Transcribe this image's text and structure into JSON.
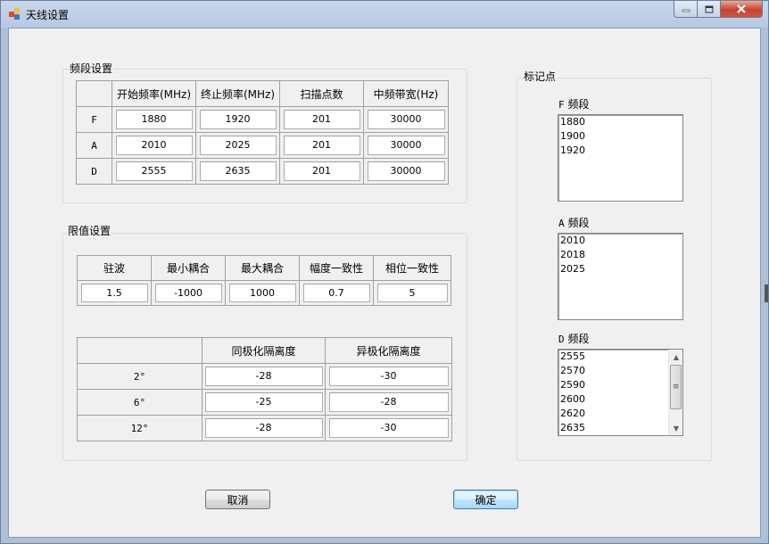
{
  "window": {
    "title": "天线设置",
    "minimize": "─",
    "maximize": "□",
    "close": "✕"
  },
  "band_group": {
    "label": "频段设置",
    "headers": [
      "",
      "开始频率(MHz)",
      "终止频率(MHz)",
      "扫描点数",
      "中频带宽(Hz)"
    ],
    "rows": [
      {
        "band": "F",
        "start": "1880",
        "stop": "1920",
        "points": "201",
        "ifbw": "30000"
      },
      {
        "band": "A",
        "start": "2010",
        "stop": "2025",
        "points": "201",
        "ifbw": "30000"
      },
      {
        "band": "D",
        "start": "2555",
        "stop": "2635",
        "points": "201",
        "ifbw": "30000"
      }
    ]
  },
  "limit_group": {
    "label": "限值设置",
    "limit_headers": [
      "驻波",
      "最小耦合",
      "最大耦合",
      "幅度一致性",
      "相位一致性"
    ],
    "limit_values": [
      "1.5",
      "-1000",
      "1000",
      "0.7",
      "5"
    ],
    "iso_headers": [
      "",
      "同极化隔离度",
      "异极化隔离度"
    ],
    "iso_rows": [
      {
        "angle": "2°",
        "co": "-28",
        "cross": "-30"
      },
      {
        "angle": "6°",
        "co": "-25",
        "cross": "-28"
      },
      {
        "angle": "12°",
        "co": "-28",
        "cross": "-30"
      }
    ]
  },
  "marker_group": {
    "label": "标记点",
    "f_label_prefix": "F",
    "f_label": "频段",
    "f_items": [
      "1880",
      "1900",
      "1920"
    ],
    "a_label_prefix": "A",
    "a_label": "频段",
    "a_items": [
      "2010",
      "2018",
      "2025"
    ],
    "d_label_prefix": "D",
    "d_label": "频段",
    "d_items": [
      "2555",
      "2570",
      "2590",
      "2600",
      "2620",
      "2635"
    ]
  },
  "buttons": {
    "cancel": "取消",
    "ok": "确定"
  },
  "colors": {
    "frame": "#aebfd6",
    "client": "#f0f0f0",
    "close_button": "#c7432d",
    "default_button_border": "#3c7fb1"
  }
}
